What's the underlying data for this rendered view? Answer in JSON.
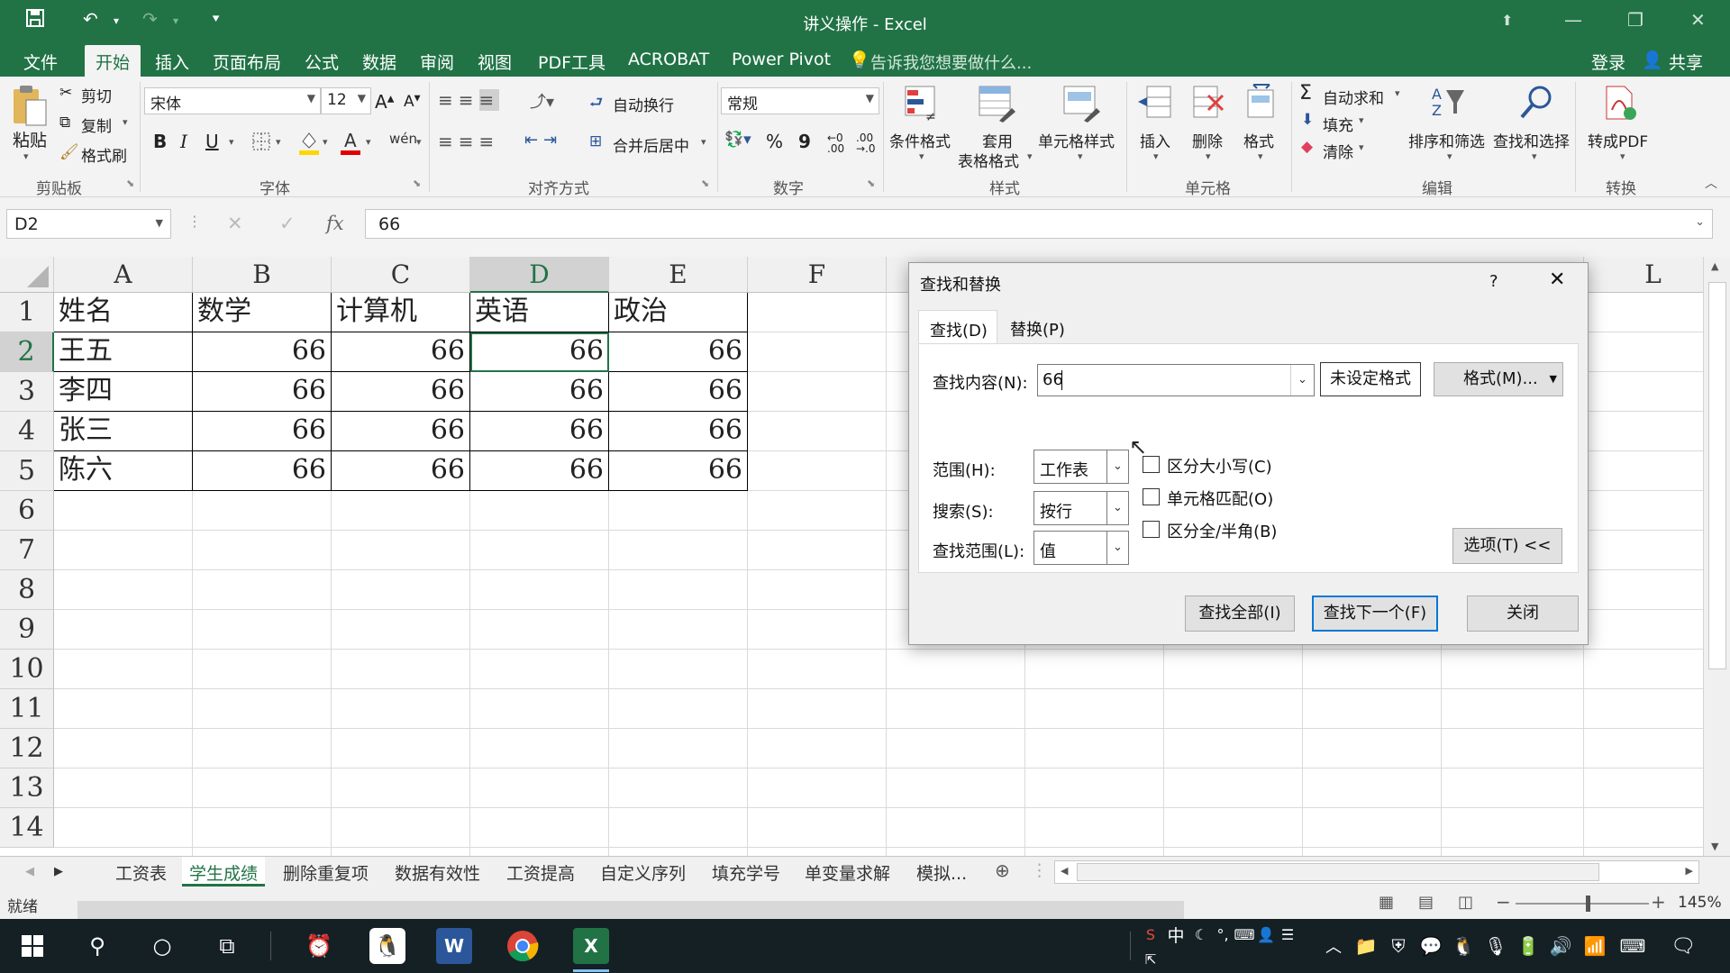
{
  "window": {
    "title": "讲义操作 - Excel"
  },
  "menu": {
    "items": [
      "文件",
      "开始",
      "插入",
      "页面布局",
      "公式",
      "数据",
      "审阅",
      "视图",
      "PDF工具",
      "ACROBAT",
      "Power Pivot"
    ],
    "tell_me": "告诉我您想要做什么...",
    "login": "登录",
    "share": "共享"
  },
  "ribbon": {
    "clipboard": {
      "paste": "粘贴",
      "cut": "剪切",
      "copy": "复制",
      "format_painter": "格式刷",
      "label": "剪贴板"
    },
    "font": {
      "name": "宋体",
      "size": "12",
      "bold": "B",
      "italic": "I",
      "underline": "U",
      "label": "字体"
    },
    "alignment": {
      "wrap": "自动换行",
      "merge": "合并后居中",
      "label": "对齐方式"
    },
    "number": {
      "format": "常规",
      "percent": "%",
      "comma": "9",
      "label": "数字"
    },
    "styles": {
      "conditional": "条件格式",
      "table_fmt_1": "套用",
      "table_fmt_2": "表格格式",
      "cell_styles": "单元格样式",
      "label": "样式"
    },
    "cells": {
      "insert": "插入",
      "delete": "删除",
      "format": "格式",
      "label": "单元格"
    },
    "editing": {
      "autosum": "自动求和",
      "fill": "填充",
      "clear": "清除",
      "sort": "排序和筛选",
      "find": "查找和选择",
      "label": "编辑"
    },
    "convert": {
      "to_pdf": "转成PDF",
      "label": "转换"
    }
  },
  "formula_bar": {
    "name_box": "D2",
    "cancel": "✕",
    "enter": "✓",
    "fx": "fx",
    "value": "66"
  },
  "sheet": {
    "columns": [
      "A",
      "B",
      "C",
      "D",
      "E",
      "F",
      "L"
    ],
    "rows": [
      "1",
      "2",
      "3",
      "4",
      "5",
      "6",
      "7",
      "8",
      "9",
      "10",
      "11",
      "12",
      "13",
      "14"
    ],
    "header": [
      "姓名",
      "数学",
      "计算机",
      "英语",
      "政治"
    ],
    "data": [
      [
        "王五",
        "66",
        "66",
        "66",
        "66"
      ],
      [
        "李四",
        "66",
        "66",
        "66",
        "66"
      ],
      [
        "张三",
        "66",
        "66",
        "66",
        "66"
      ],
      [
        "陈六",
        "66",
        "66",
        "66",
        "66"
      ]
    ],
    "selected_cell": "D2"
  },
  "sheet_tabs": [
    "工资表",
    "学生成绩",
    "删除重复项",
    "数据有效性",
    "工资提高",
    "自定义序列",
    "填充学号",
    "单变量求解",
    "模拟..."
  ],
  "active_tab": "学生成绩",
  "status": {
    "ready": "就绪",
    "zoom": "145%"
  },
  "dialog": {
    "title": "查找和替换",
    "help": "?",
    "tabs": [
      "查找(D)",
      "替换(P)"
    ],
    "find_label": "查找内容(N):",
    "find_value": "66",
    "no_format": "未设定格式",
    "format_btn": "格式(M)...",
    "within_label": "范围(H):",
    "within_value": "工作表",
    "search_label": "搜索(S):",
    "search_value": "按行",
    "lookin_label": "查找范围(L):",
    "lookin_value": "值",
    "match_case": "区分大小写(C)",
    "match_cell": "单元格匹配(O)",
    "match_byte": "区分全/半角(B)",
    "options_btn": "选项(T) <<",
    "find_all": "查找全部(I)",
    "find_next": "查找下一个(F)",
    "close": "关闭"
  },
  "taskbar": {
    "ime": "中",
    "colors": {
      "excel": "#217346",
      "word": "#2b579a"
    }
  }
}
